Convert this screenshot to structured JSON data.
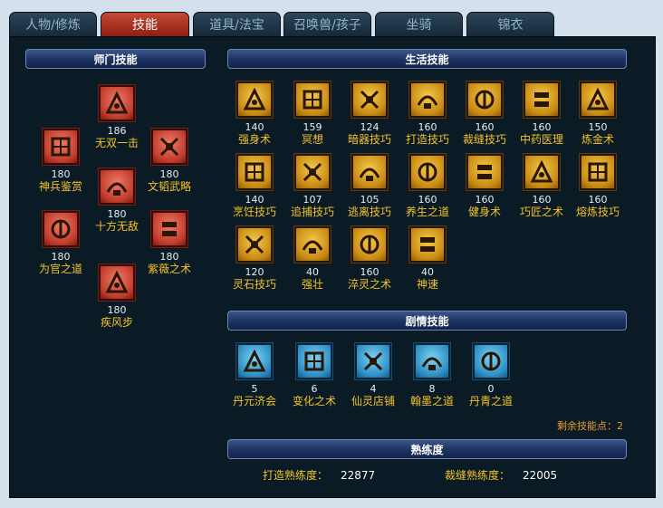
{
  "tabs": [
    "人物/修炼",
    "技能",
    "道具/法宝",
    "召唤兽/孩子",
    "坐骑",
    "锦衣"
  ],
  "active_tab": 1,
  "school": {
    "header": "师门技能",
    "skills": [
      {
        "name": "无双一击",
        "level": "186",
        "icon": "clenched-fist-icon"
      },
      {
        "name": "神兵鉴赏",
        "level": "180",
        "icon": "weapon-appraisal-icon"
      },
      {
        "name": "文韬武略",
        "level": "180",
        "icon": "scroll-strategy-icon"
      },
      {
        "name": "十方无敌",
        "level": "180",
        "icon": "crossed-blades-icon"
      },
      {
        "name": "为官之道",
        "level": "180",
        "icon": "official-seal-icon"
      },
      {
        "name": "紫薇之术",
        "level": "180",
        "icon": "star-gate-icon"
      },
      {
        "name": "疾风步",
        "level": "180",
        "icon": "swift-step-icon"
      }
    ]
  },
  "life": {
    "header": "生活技能",
    "skills": [
      {
        "name": "强身术",
        "level": "140",
        "icon": "body-strength-icon"
      },
      {
        "name": "冥想",
        "level": "159",
        "icon": "meditation-icon"
      },
      {
        "name": "暗器技巧",
        "level": "124",
        "icon": "hidden-weapon-icon"
      },
      {
        "name": "打造技巧",
        "level": "160",
        "icon": "forging-hammer-icon"
      },
      {
        "name": "裁缝技巧",
        "level": "160",
        "icon": "tailoring-icon"
      },
      {
        "name": "中药医理",
        "level": "160",
        "icon": "herbal-medicine-icon"
      },
      {
        "name": "炼金术",
        "level": "150",
        "icon": "alchemy-icon"
      },
      {
        "name": "烹饪技巧",
        "level": "140",
        "icon": "cooking-icon"
      },
      {
        "name": "追捕技巧",
        "level": "107",
        "icon": "pursuit-icon"
      },
      {
        "name": "逃离技巧",
        "level": "105",
        "icon": "escape-icon"
      },
      {
        "name": "养生之道",
        "level": "160",
        "icon": "health-cultivation-icon"
      },
      {
        "name": "健身术",
        "level": "160",
        "icon": "fitness-icon"
      },
      {
        "name": "巧匠之术",
        "level": "160",
        "icon": "craftsman-icon"
      },
      {
        "name": "熔炼技巧",
        "level": "160",
        "icon": "smelting-icon"
      },
      {
        "name": "灵石技巧",
        "level": "120",
        "icon": "spirit-stone-icon"
      },
      {
        "name": "强壮",
        "level": "40",
        "icon": "muscle-icon"
      },
      {
        "name": "淬灵之术",
        "level": "160",
        "icon": "tempering-bowl-icon"
      },
      {
        "name": "神速",
        "level": "40",
        "icon": "divine-speed-icon"
      }
    ]
  },
  "story": {
    "header": "剧情技能",
    "skills": [
      {
        "name": "丹元济会",
        "level": "5",
        "icon": "elixir-icon"
      },
      {
        "name": "变化之术",
        "level": "6",
        "icon": "transformation-icon"
      },
      {
        "name": "仙灵店铺",
        "level": "4",
        "icon": "spirit-shop-icon"
      },
      {
        "name": "翰墨之道",
        "level": "8",
        "icon": "ink-brush-icon"
      },
      {
        "name": "丹青之道",
        "level": "0",
        "icon": "painting-scroll-icon"
      }
    ]
  },
  "remaining_points_text": "剩余技能点：2",
  "proficiency": {
    "header": "熟练度",
    "forging_label": "打造熟练度：",
    "forging_value": "22877",
    "tailoring_label": "裁缝熟练度：",
    "tailoring_value": "22005"
  }
}
